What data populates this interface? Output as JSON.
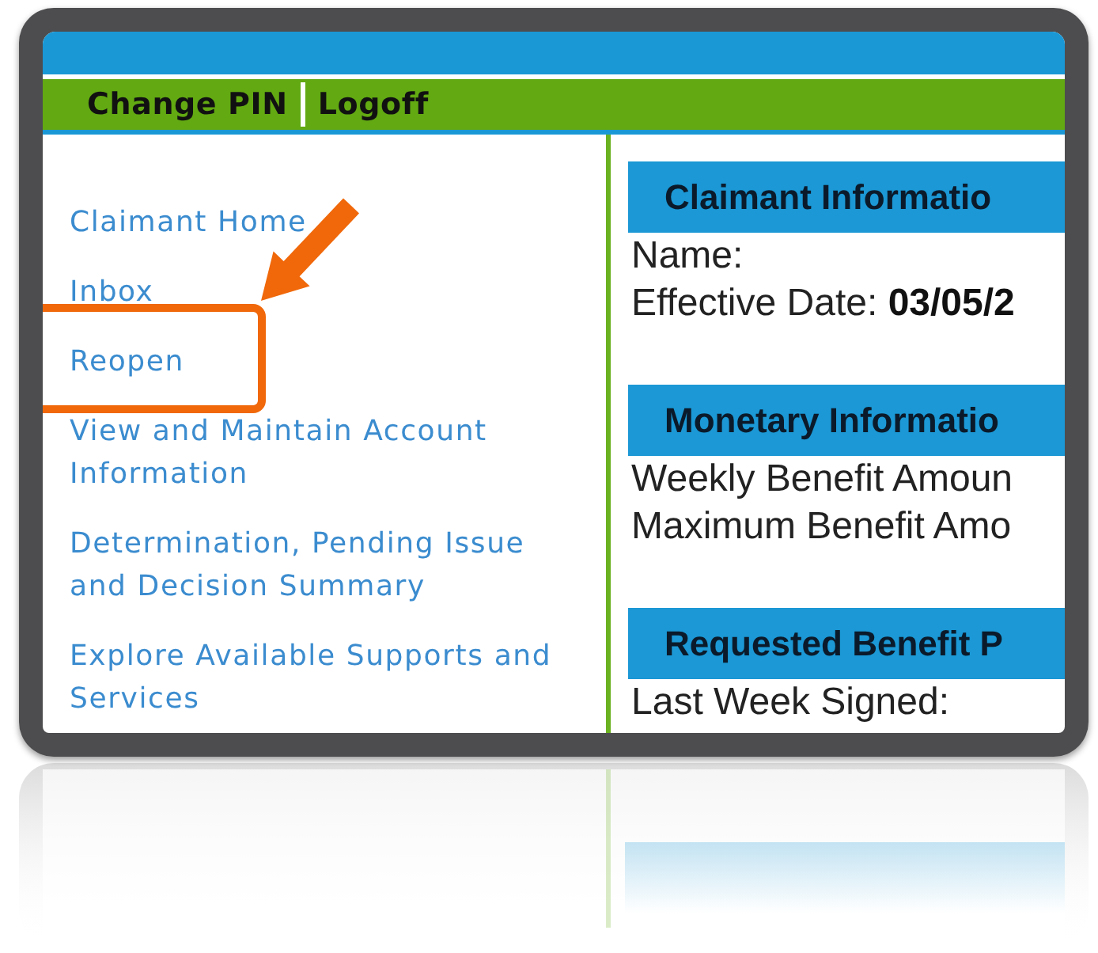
{
  "top_links": [
    {
      "label": "Change PIN"
    },
    {
      "label": "Logoff"
    }
  ],
  "sidebar": {
    "items": [
      {
        "label": "Claimant Home",
        "highlighted": false
      },
      {
        "label": "Inbox",
        "highlighted": false
      },
      {
        "label": "Reopen",
        "highlighted": true
      },
      {
        "label": "View and Maintain Account Information",
        "highlighted": false
      },
      {
        "label": "Determination, Pending Issue and Decision Summary",
        "highlighted": false
      },
      {
        "label": "Explore Available Supports and Services",
        "highlighted": false
      }
    ]
  },
  "sections": [
    {
      "title": "Claimant Informatio",
      "fields": [
        {
          "label": "Name:"
        },
        {
          "label": "Effective Date:",
          "value": "03/05/2"
        }
      ]
    },
    {
      "title": "Monetary Informatio",
      "fields": [
        {
          "label": "Weekly Benefit Amoun"
        },
        {
          "label": "Maximum Benefit Amo"
        }
      ]
    },
    {
      "title": "Requested Benefit P",
      "fields": [
        {
          "label": "Last Week Signed:"
        }
      ]
    }
  ]
}
